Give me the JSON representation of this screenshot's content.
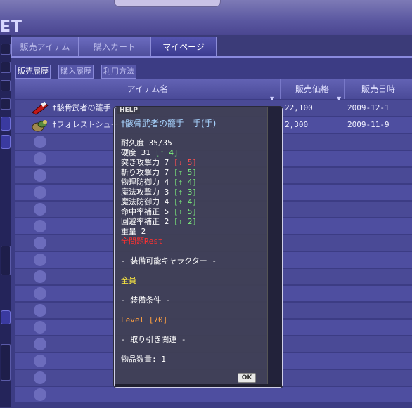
{
  "banner": {
    "label": "",
    "logo": "ET"
  },
  "main_tabs": [
    {
      "label": "販売アイテム",
      "active": false
    },
    {
      "label": "購入カート",
      "active": false
    },
    {
      "label": "マイページ",
      "active": true
    }
  ],
  "sub_tabs": [
    {
      "label": "販売履歴",
      "active": true
    },
    {
      "label": "購入履歴",
      "active": false
    },
    {
      "label": "利用方法",
      "active": false
    }
  ],
  "table": {
    "headers": {
      "item": "アイテム名",
      "price": "販売価格",
      "date": "販売日時"
    },
    "rows": [
      {
        "icon": "gauntlet-icon",
        "name": "†骸骨武者の籠手",
        "price": "22,100",
        "date": "2009-12-1"
      },
      {
        "icon": "forest-shoe-icon",
        "name": "†フォレストシュー",
        "price": "2,300",
        "date": "2009-11-9"
      }
    ]
  },
  "tooltip": {
    "help": "HELP",
    "title": "†骸骨武者の籠手 - 手(手)",
    "durability": "耐久度 35/35",
    "stats": [
      {
        "label": "硬度 31 ",
        "bonus": "[↑ 4]",
        "kind": "up"
      },
      {
        "label": "突き攻撃力 7 ",
        "bonus": "[↓ 5]",
        "kind": "down"
      },
      {
        "label": "斬り攻撃力 7 ",
        "bonus": "[↑ 5]",
        "kind": "up"
      },
      {
        "label": "物理防御力 4 ",
        "bonus": "[↑ 4]",
        "kind": "up"
      },
      {
        "label": "魔法攻撃力 3 ",
        "bonus": "[↑ 3]",
        "kind": "up"
      },
      {
        "label": "魔法防御力 4 ",
        "bonus": "[↑ 4]",
        "kind": "up"
      },
      {
        "label": "命中率補正 5 ",
        "bonus": "[↑ 5]",
        "kind": "up"
      },
      {
        "label": "回避率補正 2 ",
        "bonus": "[↑ 2]",
        "kind": "up"
      }
    ],
    "weight": "重量 2",
    "attribute": "全問題Rest",
    "equip_chars_header": "- 装備可能キャラクター -",
    "equip_chars": "全員",
    "equip_cond_header": "- 装備条件 -",
    "equip_cond": "Level [70]",
    "trade_header": "- 取り引き関連 -",
    "quantity": "物品数量: 1",
    "ok": "OK"
  },
  "colors": {
    "accent": "#3c3c84",
    "tooltip_title": "#a8d4ff",
    "stat_up": "#7df07d",
    "stat_down": "#ff5050"
  }
}
